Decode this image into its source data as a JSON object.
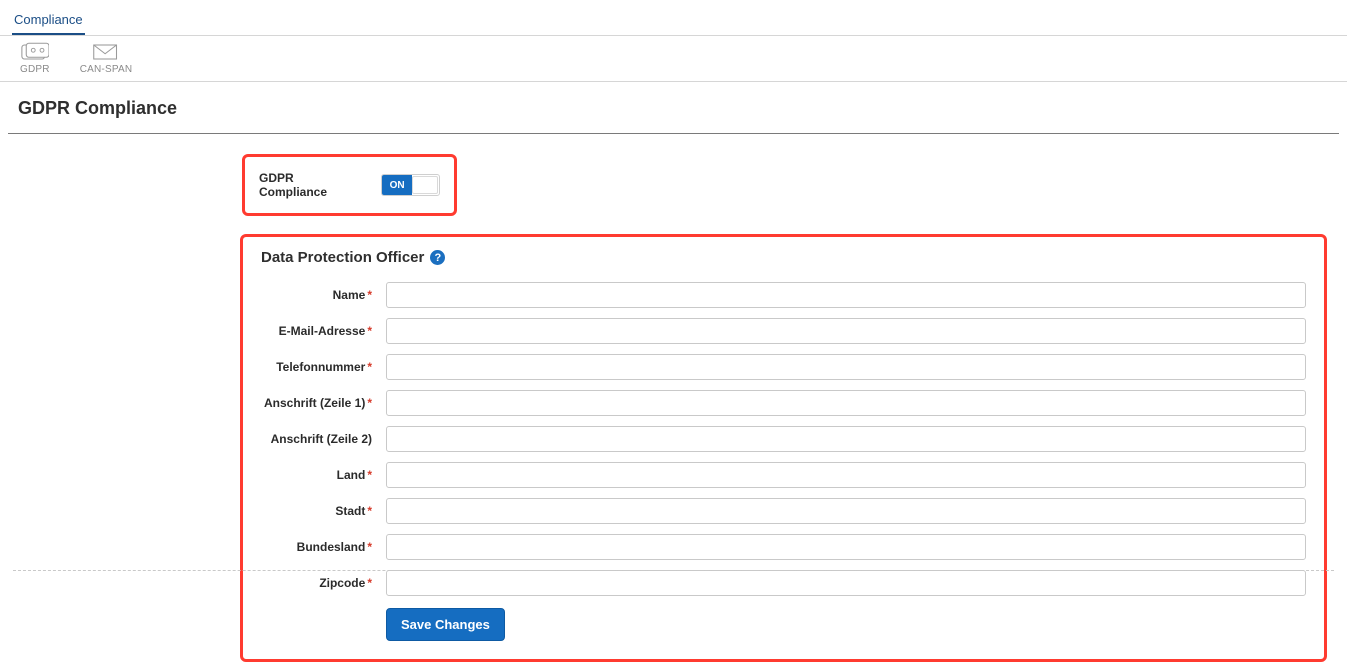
{
  "top_tab": {
    "label": "Compliance"
  },
  "icon_tabs": {
    "gdpr": "GDPR",
    "canspan": "CAN-SPAN"
  },
  "page": {
    "title": "GDPR Compliance"
  },
  "toggle": {
    "label": "GDPR Compliance",
    "on_text": "ON"
  },
  "section": {
    "title": "Data Protection Officer"
  },
  "fields": {
    "name": {
      "label": "Name",
      "required": true,
      "value": ""
    },
    "email": {
      "label": "E-Mail-Adresse",
      "required": true,
      "value": ""
    },
    "phone": {
      "label": "Telefonnummer",
      "required": true,
      "value": ""
    },
    "addr1": {
      "label": "Anschrift (Zeile 1)",
      "required": true,
      "value": ""
    },
    "addr2": {
      "label": "Anschrift (Zeile 2)",
      "required": false,
      "value": ""
    },
    "country": {
      "label": "Land",
      "required": true,
      "value": ""
    },
    "city": {
      "label": "Stadt",
      "required": true,
      "value": ""
    },
    "state": {
      "label": "Bundesland",
      "required": true,
      "value": ""
    },
    "zip": {
      "label": "Zipcode",
      "required": true,
      "value": ""
    }
  },
  "buttons": {
    "save": "Save Changes"
  },
  "required_marker": "*"
}
